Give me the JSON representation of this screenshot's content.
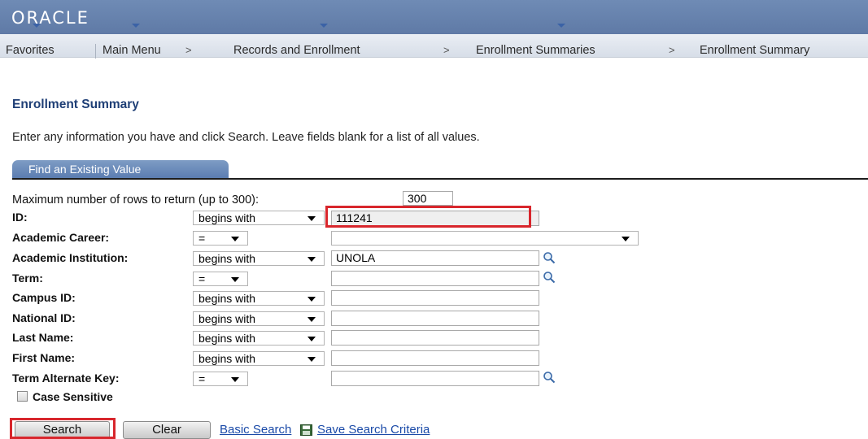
{
  "header": {
    "logo": "ORACLE"
  },
  "nav": {
    "items": [
      "Favorites",
      "Main Menu",
      "Records and Enrollment",
      "Enrollment Summaries",
      "Enrollment Summary"
    ],
    "separator": ">"
  },
  "page": {
    "title": "Enrollment Summary",
    "instructions": "Enter any information you have and click Search. Leave fields blank for a list of all values."
  },
  "tab": {
    "label": "Find an Existing Value"
  },
  "form": {
    "max_rows_label": "Maximum number of rows to return (up to 300):",
    "max_rows_value": "300",
    "fields": [
      {
        "label": "ID:",
        "operator": "begins with",
        "value": "111241"
      },
      {
        "label": "Academic Career:",
        "operator": "=",
        "value": ""
      },
      {
        "label": "Academic Institution:",
        "operator": "begins with",
        "value": "UNOLA"
      },
      {
        "label": "Term:",
        "operator": "=",
        "value": ""
      },
      {
        "label": "Campus ID:",
        "operator": "begins with",
        "value": ""
      },
      {
        "label": "National ID:",
        "operator": "begins with",
        "value": ""
      },
      {
        "label": "Last Name:",
        "operator": "begins with",
        "value": ""
      },
      {
        "label": "First Name:",
        "operator": "begins with",
        "value": ""
      },
      {
        "label": "Term Alternate Key:",
        "operator": "=",
        "value": ""
      }
    ],
    "case_sensitive_label": "Case Sensitive"
  },
  "actions": {
    "search": "Search",
    "clear": "Clear",
    "basic_search": "Basic Search",
    "save_search": "Save Search Criteria"
  },
  "colors": {
    "highlight": "#d8262c",
    "header": "#6f8bb5",
    "title": "#1f3f76",
    "link": "#1a4aa8"
  }
}
